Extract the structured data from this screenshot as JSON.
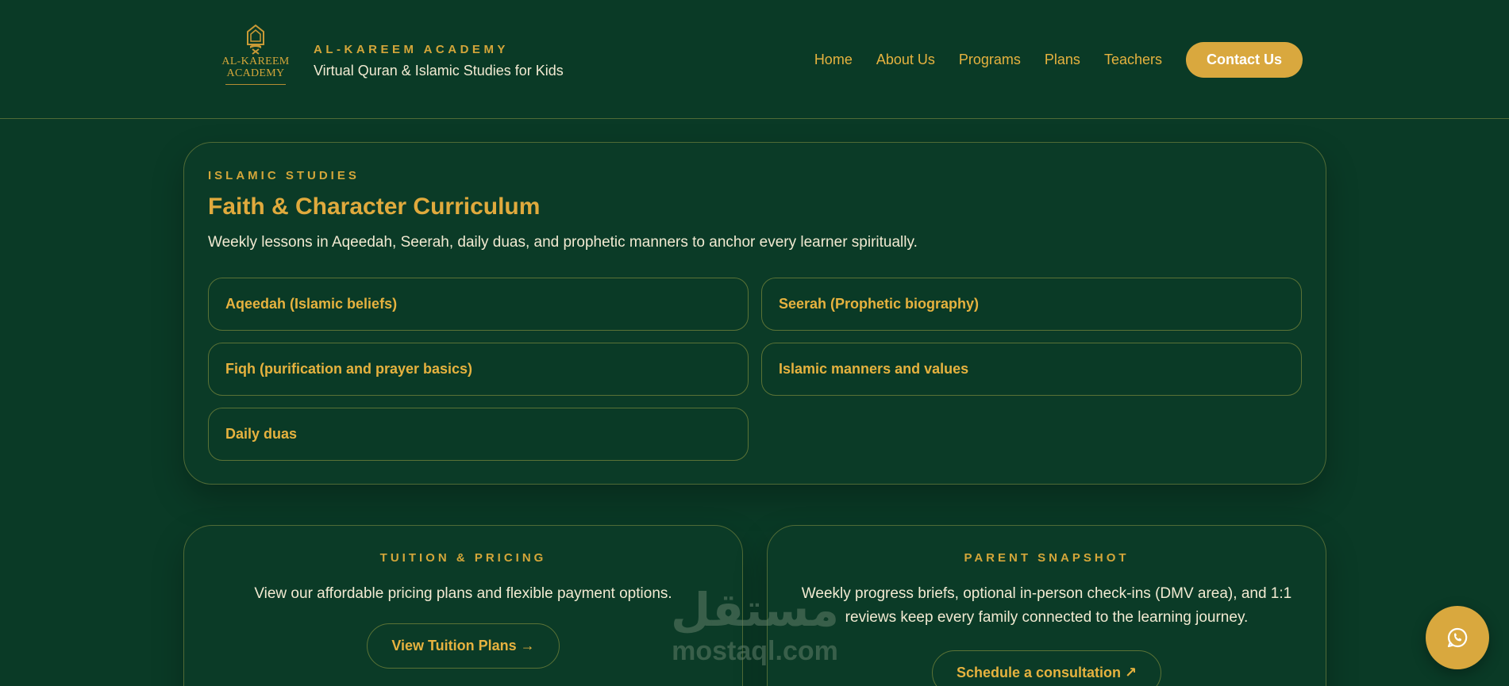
{
  "header": {
    "logo_text_line1": "AL-KAREEM",
    "logo_text_line2": "ACADEMY",
    "brand_name": "AL-KAREEM ACADEMY",
    "tagline": "Virtual Quran & Islamic Studies for Kids",
    "nav": [
      "Home",
      "About Us",
      "Programs",
      "Plans",
      "Teachers"
    ],
    "cta": "Contact Us"
  },
  "curriculum": {
    "eyebrow": "ISLAMIC STUDIES",
    "title": "Faith & Character Curriculum",
    "description": "Weekly lessons in Aqeedah, Seerah, daily duas, and prophetic manners to anchor every learner spiritually.",
    "topics": [
      "Aqeedah (Islamic beliefs)",
      "Seerah (Prophetic biography)",
      "Fiqh (purification and prayer basics)",
      "Islamic manners and values",
      "Daily duas"
    ]
  },
  "tuition": {
    "eyebrow": "TUITION & PRICING",
    "text": "View our affordable pricing plans and flexible payment options.",
    "button": "View Tuition Plans →"
  },
  "snapshot": {
    "eyebrow": "PARENT SNAPSHOT",
    "text": "Weekly progress briefs, optional in-person check-ins (DMV area), and 1:1 reviews keep every family connected to the learning journey.",
    "button": "Schedule a consultation ↗"
  },
  "watermark": {
    "arabic": "مستقل",
    "latin": "mostaql.com"
  },
  "colors": {
    "background": "#0a3a26",
    "gold": "#d4a63a",
    "cream": "#f2ead2"
  },
  "icons": {
    "logo": "mosque-book-icon",
    "chat": "whatsapp-icon"
  }
}
